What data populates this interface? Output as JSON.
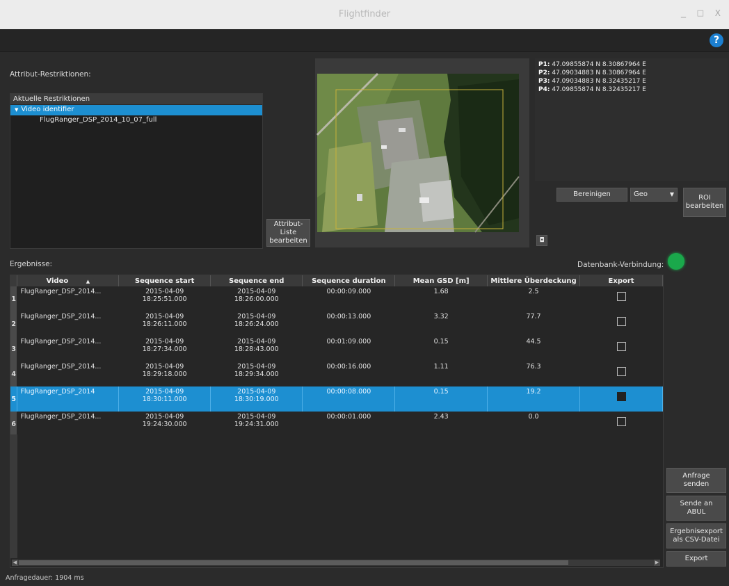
{
  "window": {
    "title": "Flightfinder",
    "minimize_glyph": "_",
    "maximize_glyph": "□",
    "close_glyph": "X",
    "help_label": "?"
  },
  "restrictions": {
    "heading": "Attribut-Restriktionen:",
    "tree_header": "Aktuelle Restriktionen",
    "tree_items": [
      {
        "label": "Video identifier",
        "selected": true,
        "icon": "expand-arrow-icon"
      },
      {
        "label": "FlugRanger_DSP_2014_10_07_full",
        "selected": false
      }
    ],
    "edit_list_button": "Attribut-\nListe\nbearbeiten"
  },
  "map_panel": {
    "coordinates": [
      {
        "label": "P1:",
        "value": "47.09855874 N 8.30867964 E"
      },
      {
        "label": "P2:",
        "value": "47.09034883 N 8.30867964 E"
      },
      {
        "label": "P3:",
        "value": "47.09034883 N 8.32435217 E"
      },
      {
        "label": "P4:",
        "value": "47.09855874 N 8.32435217 E"
      }
    ],
    "clear_button": "Bereinigen",
    "mode_select": "Geo",
    "edit_roi_button": "ROI\nbearbeiten",
    "small_icon": "map-toggle-icon"
  },
  "results": {
    "heading": "Ergebnisse:",
    "db_connection_label": "Datenbank-Verbindung:",
    "db_status_color": "#1aa84b",
    "columns": [
      "Video",
      "Sequence start",
      "Sequence end",
      "Sequence duration",
      "Mean GSD [m]",
      "Mittlere Überdeckung",
      "Export"
    ],
    "sort_indicator": "▲",
    "rows": [
      {
        "num": "1",
        "video": "FlugRanger_DSP_2014...",
        "start_date": "2015-04-09",
        "start_time": "18:25:51.000",
        "end_date": "2015-04-09",
        "end_time": "18:26:00.000",
        "duration": "00:00:09.000",
        "gsd": "1.68",
        "overlap": "2.5",
        "export": false,
        "selected": false
      },
      {
        "num": "2",
        "video": "FlugRanger_DSP_2014...",
        "start_date": "2015-04-09",
        "start_time": "18:26:11.000",
        "end_date": "2015-04-09",
        "end_time": "18:26:24.000",
        "duration": "00:00:13.000",
        "gsd": "3.32",
        "overlap": "77.7",
        "export": false,
        "selected": false
      },
      {
        "num": "3",
        "video": "FlugRanger_DSP_2014...",
        "start_date": "2015-04-09",
        "start_time": "18:27:34.000",
        "end_date": "2015-04-09",
        "end_time": "18:28:43.000",
        "duration": "00:01:09.000",
        "gsd": "0.15",
        "overlap": "44.5",
        "export": false,
        "selected": false
      },
      {
        "num": "4",
        "video": "FlugRanger_DSP_2014...",
        "start_date": "2015-04-09",
        "start_time": "18:29:18.000",
        "end_date": "2015-04-09",
        "end_time": "18:29:34.000",
        "duration": "00:00:16.000",
        "gsd": "1.11",
        "overlap": "76.3",
        "export": false,
        "selected": false
      },
      {
        "num": "5",
        "video": "FlugRanger_DSP_2014",
        "start_date": "2015-04-09",
        "start_time": "18:30:11.000",
        "end_date": "2015-04-09",
        "end_time": "18:30:19.000",
        "duration": "00:00:08.000",
        "gsd": "0.15",
        "overlap": "19.2",
        "export": true,
        "selected": true
      },
      {
        "num": "6",
        "video": "FlugRanger_DSP_2014...",
        "start_date": "2015-04-09",
        "start_time": "19:24:30.000",
        "end_date": "2015-04-09",
        "end_time": "19:24:31.000",
        "duration": "00:00:01.000",
        "gsd": "2.43",
        "overlap": "0.0",
        "export": false,
        "selected": false
      }
    ]
  },
  "actions": {
    "send_query": "Anfrage\nsenden",
    "send_abul": "Sende an\nABUL",
    "csv_export": "Ergebnisexport\nals CSV-Datei",
    "export": "Export"
  },
  "status": {
    "query_duration": "Anfragedauer: 1904 ms"
  }
}
